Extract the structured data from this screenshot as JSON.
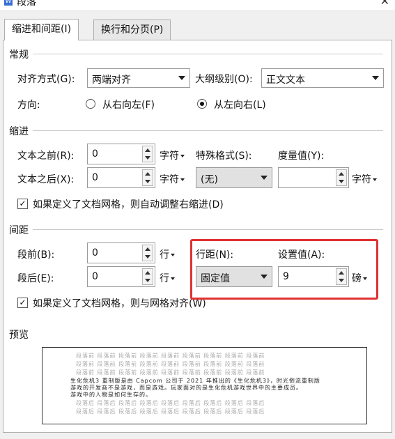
{
  "window": {
    "title": "段落",
    "close_glyph": "✕"
  },
  "tabs": [
    {
      "label": "缩进和间距(I)",
      "active": true
    },
    {
      "label": "换行和分页(P)",
      "active": false
    }
  ],
  "general": {
    "title": "常规",
    "alignment_label": "对齐方式(G):",
    "alignment_value": "两端对齐",
    "outline_label": "大纲级别(O):",
    "outline_value": "正文文本",
    "direction_label": "方向:",
    "rtl_label": "从右向左(F)",
    "ltr_label": "从左向右(L)",
    "selected_direction": "ltr"
  },
  "indent": {
    "title": "缩进",
    "before_label": "文本之前(R):",
    "before_value": "0",
    "before_unit": "字符",
    "after_label": "文本之后(X):",
    "after_value": "0",
    "after_unit": "字符",
    "special_label": "特殊格式(S):",
    "special_value": "(无)",
    "measure_label": "度量值(Y):",
    "measure_value": "",
    "measure_unit": "字符",
    "auto_adjust_label": "如果定义了文档网格，则自动调整右缩进(D)",
    "auto_adjust_checked": true
  },
  "spacing": {
    "title": "间距",
    "before_label": "段前(B):",
    "before_value": "0",
    "before_unit": "行",
    "after_label": "段后(E):",
    "after_value": "0",
    "after_unit": "行",
    "line_spacing_label": "行距(N):",
    "line_spacing_value": "固定值",
    "setting_label": "设置值(A):",
    "setting_value": "9",
    "setting_unit": "磅",
    "snap_grid_label": "如果定义了文档网格，则与网格对齐(W)",
    "snap_grid_checked": true,
    "highlight_color": "#e03131"
  },
  "preview": {
    "title": "预览",
    "lines": [
      "段落前  段落前  段落前  段落前  段落前  段落前  段落前  段落前  段落前",
      "段落前  段落前  段落前  段落前  段落前  段落前  段落前  段落前  段落前",
      "段落前  段落前  段落前  段落前  段落前  段落前  段落前  段落前  段落前",
      "生化危机3 重制版是由 Capcom 公司于 2021 年推出的《生化危机3》，时光倒流重制版",
      "游戏的开发商不是游戏，而是游戏。玩家面对的是生化危机游戏世界中的主要成员。",
      "游戏中的人物是如何生存的。",
      "段落后  段落后  段落后  段落后  段落后  段落后  段落后  段落后  段落后",
      "段落后  段落后  段落后  段落后  段落后  段落后  段落后  段落后  段落后"
    ]
  }
}
